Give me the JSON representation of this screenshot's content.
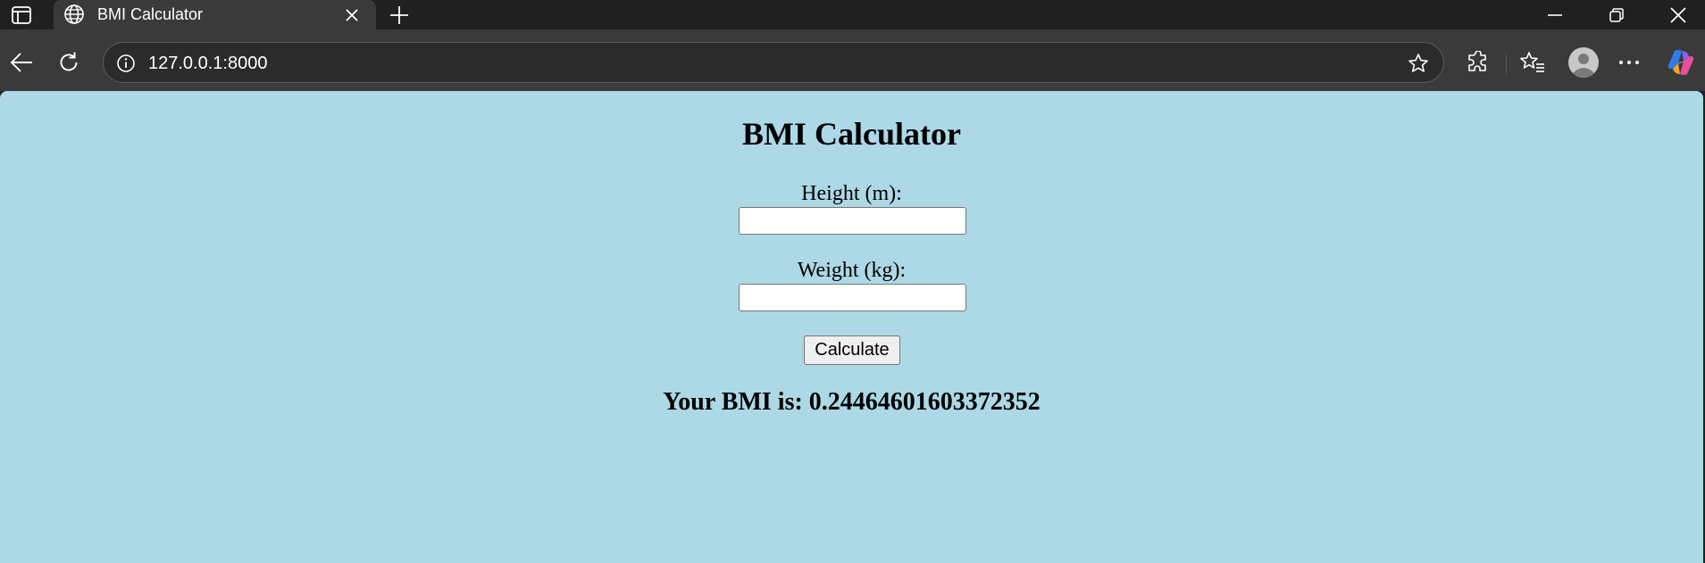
{
  "browser": {
    "tab": {
      "title": "BMI Calculator"
    },
    "address": {
      "url": "127.0.0.1:8000"
    }
  },
  "page": {
    "title": "BMI Calculator",
    "height_label": "Height (m):",
    "height_value": "",
    "weight_label": "Weight (kg):",
    "weight_value": "",
    "calculate_label": "Calculate",
    "result_text": "Your BMI is: 0.24464601603372352"
  },
  "colors": {
    "page_background": "#add8e6",
    "browser_chrome": "#202020",
    "toolbar": "#3a3a3a"
  },
  "icons": [
    "tab-sidebar-icon",
    "globe-icon",
    "close-icon",
    "plus-icon",
    "minimize-icon",
    "restore-icon",
    "window-close-icon",
    "back-arrow-icon",
    "refresh-icon",
    "info-icon",
    "star-icon",
    "extensions-icon",
    "favorites-icon",
    "profile-icon",
    "more-icon",
    "copilot-icon"
  ]
}
